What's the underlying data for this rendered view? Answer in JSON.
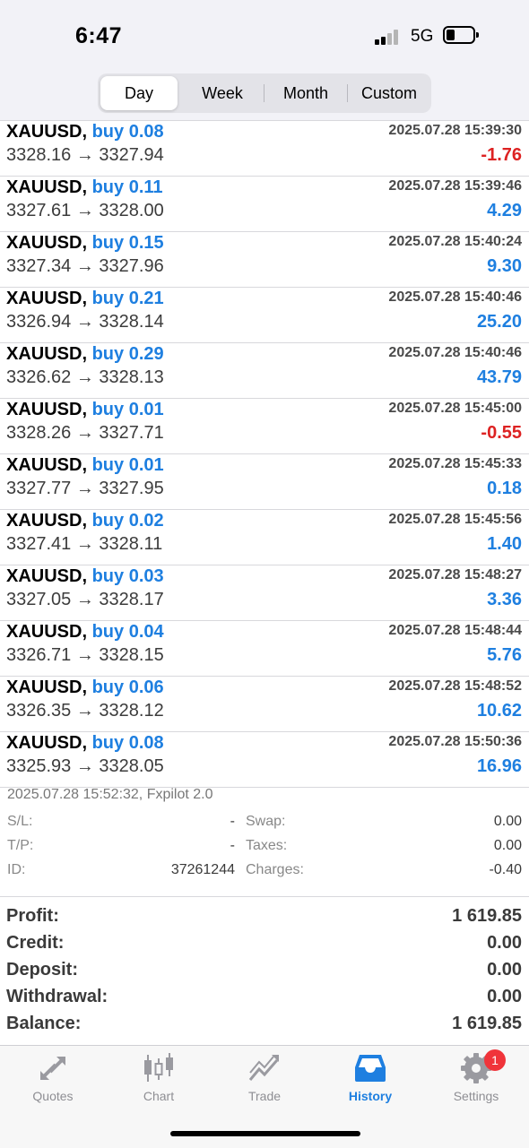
{
  "status_bar": {
    "time": "6:47",
    "network": "5G"
  },
  "period_tabs": [
    {
      "label": "Day",
      "active": true
    },
    {
      "label": "Week",
      "active": false
    },
    {
      "label": "Month",
      "active": false
    },
    {
      "label": "Custom",
      "active": false
    }
  ],
  "deals": [
    {
      "symbol": "XAUUSD,",
      "type": "buy 0.08",
      "time": "2025.07.28 15:39:30",
      "prices": "3328.16 → 3327.94",
      "profit": "-1.76"
    },
    {
      "symbol": "XAUUSD,",
      "type": "buy 0.11",
      "time": "2025.07.28 15:39:46",
      "prices": "3327.61 → 3328.00",
      "profit": "4.29"
    },
    {
      "symbol": "XAUUSD,",
      "type": "buy 0.15",
      "time": "2025.07.28 15:40:24",
      "prices": "3327.34 → 3327.96",
      "profit": "9.30"
    },
    {
      "symbol": "XAUUSD,",
      "type": "buy 0.21",
      "time": "2025.07.28 15:40:46",
      "prices": "3326.94 → 3328.14",
      "profit": "25.20"
    },
    {
      "symbol": "XAUUSD,",
      "type": "buy 0.29",
      "time": "2025.07.28 15:40:46",
      "prices": "3326.62 → 3328.13",
      "profit": "43.79"
    },
    {
      "symbol": "XAUUSD,",
      "type": "buy 0.01",
      "time": "2025.07.28 15:45:00",
      "prices": "3328.26 → 3327.71",
      "profit": "-0.55"
    },
    {
      "symbol": "XAUUSD,",
      "type": "buy 0.01",
      "time": "2025.07.28 15:45:33",
      "prices": "3327.77 → 3327.95",
      "profit": "0.18"
    },
    {
      "symbol": "XAUUSD,",
      "type": "buy 0.02",
      "time": "2025.07.28 15:45:56",
      "prices": "3327.41 → 3328.11",
      "profit": "1.40"
    },
    {
      "symbol": "XAUUSD,",
      "type": "buy 0.03",
      "time": "2025.07.28 15:48:27",
      "prices": "3327.05 → 3328.17",
      "profit": "3.36"
    },
    {
      "symbol": "XAUUSD,",
      "type": "buy 0.04",
      "time": "2025.07.28 15:48:44",
      "prices": "3326.71 → 3328.15",
      "profit": "5.76"
    },
    {
      "symbol": "XAUUSD,",
      "type": "buy 0.06",
      "time": "2025.07.28 15:48:52",
      "prices": "3326.35 → 3328.12",
      "profit": "10.62"
    },
    {
      "symbol": "XAUUSD,",
      "type": "buy 0.08",
      "time": "2025.07.28 15:50:36",
      "prices": "3325.93 → 3328.05",
      "profit": "16.96"
    }
  ],
  "detail": {
    "title": "2025.07.28 15:52:32, Fxpilot 2.0",
    "rows": [
      {
        "l1": "S/L:",
        "v1": "-",
        "l2": "Swap:",
        "v2": "0.00"
      },
      {
        "l1": "T/P:",
        "v1": "-",
        "l2": "Taxes:",
        "v2": "0.00"
      },
      {
        "l1": "ID:",
        "v1": "37261244",
        "l2": "Charges:",
        "v2": "-0.40"
      }
    ]
  },
  "summary": [
    {
      "label": "Profit:",
      "value": "1 619.85"
    },
    {
      "label": "Credit:",
      "value": "0.00"
    },
    {
      "label": "Deposit:",
      "value": "0.00"
    },
    {
      "label": "Withdrawal:",
      "value": "0.00"
    },
    {
      "label": "Balance:",
      "value": "1 619.85"
    }
  ],
  "tabbar": {
    "items": [
      {
        "label": "Quotes",
        "icon": "quotes-icon"
      },
      {
        "label": "Chart",
        "icon": "candlestick-chart-icon"
      },
      {
        "label": "Trade",
        "icon": "trade-icon"
      },
      {
        "label": "History",
        "icon": "inbox-tray-icon",
        "active": true
      },
      {
        "label": "Settings",
        "icon": "gear-icon"
      }
    ],
    "settings_badge": "1"
  },
  "colors": {
    "accent": "#1e7fe0",
    "negative": "#dd2222",
    "badge": "#f0343a",
    "inactive": "#8e8e93"
  }
}
